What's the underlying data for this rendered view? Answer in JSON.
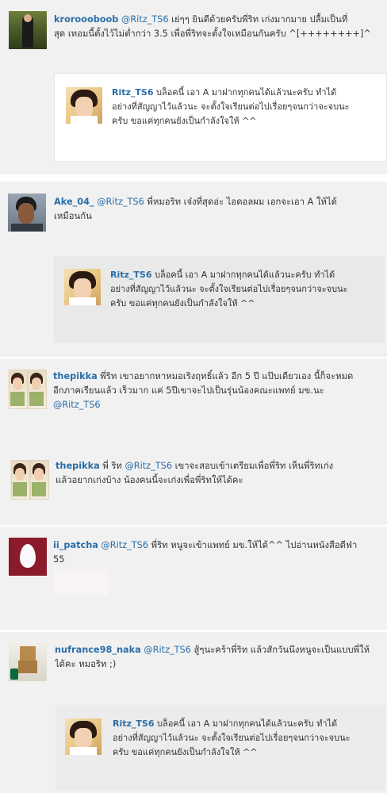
{
  "tweets": [
    {
      "username": "kroroooboob",
      "mention": "@Ritz_TS6",
      "text_line1": " เย่ๆๆ ยินดีด้วยครับพี่ริท เก่งมากมาย ปลื้มเป็นที่",
      "text_line2": "สุด เทอมนี้ตั้งไว้ไม่ต่ำกว่า 3.5 เพื่อพี่ริทจะตั้งใจเหมือนกันครับ ^[++++++++]^",
      "avatar_icon": "profile-photo-icon"
    },
    {
      "username": "Ake_04_",
      "mention": "@Ritz_TS6",
      "text_line1": " พี่หมอริท เจ๋งที่สุดอ่ะ ไอดอลผม เอกจะเอา A ให้ได้",
      "text_line2": "เหมือนกัน",
      "avatar_icon": "profile-photo-icon"
    },
    {
      "username": "thepikka",
      "text_line1": " พี่ริท เขาอยากหาหมอเริงฤทธิ์แล้ว อีก 5 ปี แป๊บเดียวเอง นี้ก็จะหมด",
      "text_line2": "อีกภาคเรียนแล้ว เร็วมาก แค่ 5ปีเขาจะไปเป็นรุ่นน้องคณะแพทย์ มข.นะ",
      "mention_line3": "@Ritz_TS6",
      "avatar_icon": "profile-photo-icon"
    },
    {
      "username": "thepikka",
      "text_pre": " พี่ ริท ",
      "mention": "@Ritz_TS6",
      "text_line1": " เขาจะสอบเข้าเตรียมเพื่อพี่ริท เห็นพี่ริทเก่ง",
      "text_line2": "แล้วอยากเก่งบ้าง น้องคนนี้จะเก่งเพื่อพี่ริทให้ได้คะ",
      "avatar_icon": "profile-photo-icon"
    },
    {
      "username": "ii_patcha",
      "mention": "@Ritz_TS6",
      "text_line1": " พี่ริท หนูจะเข้าแพทย์ มข.ให้ได้^^ ไปอ่านหนังสือดีฟ่า",
      "text_line2": "55",
      "avatar_icon": "egg-avatar-icon"
    },
    {
      "username": "nufrance98_naka",
      "mention": "@Ritz_TS6",
      "text_line1": " สู้ๆนะคร้าพี่ริท แล้วสักวันนึงหนูจะเป็นแบบพี่ให้",
      "text_line2": "ได้คะ หมอริท ;)",
      "avatar_icon": "profile-photo-icon"
    }
  ],
  "quote": {
    "username": "Ritz_TS6",
    "line1": " บล็อคนี้ เอา A มาฝากทุกคนได้แล้วนะครับ ทำได้",
    "line2": "อย่างที่สัญญาไว้แล้วนะ จะตั้งใจเรียนต่อไปเรื่อยๆจนกว่าจะจบนะ",
    "line3": "ครับ ขอแค่ทุกคนยังเป็นกำลังใจให้ ^^"
  },
  "colors": {
    "link": "#2b6ea8",
    "grey_bg": "#f1f1f1",
    "quote_bg": "#efefef"
  }
}
